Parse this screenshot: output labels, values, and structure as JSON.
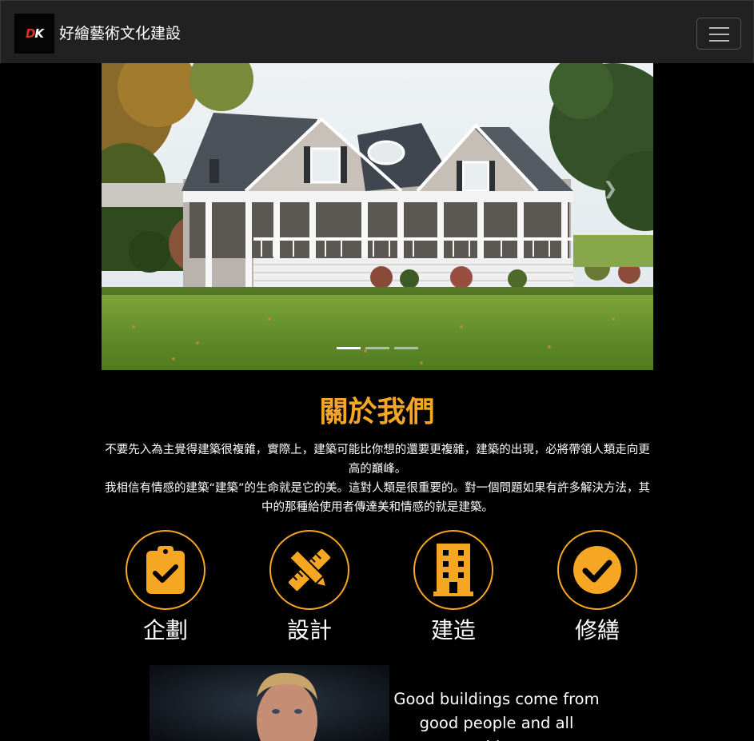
{
  "navbar": {
    "logo_text": "DK",
    "brand": "好繪藝術文化建設",
    "menu_icon": "hamburger-menu-icon"
  },
  "carousel": {
    "slide_count": 3,
    "active_slide": 1,
    "next_icon": "chevron-right-icon"
  },
  "about": {
    "title": "關於我們",
    "paragraph_1": "不要先入為主覺得建築很複雜，實際上，建築可能比你想的還要更複雜，建築的出現，必將帶領人類走向更高的巔峰。",
    "paragraph_2": "我相信有情感的建築“建築”的生命就是它的美。這對人類是很重要的。對一個問題如果有許多解決方法，其中的那種給使用者傳達美和情感的就是建築。"
  },
  "services": [
    {
      "label": "企劃",
      "icon": "clipboard-check-icon"
    },
    {
      "label": "設計",
      "icon": "pencil-ruler-icon"
    },
    {
      "label": "建造",
      "icon": "building-icon"
    },
    {
      "label": "修繕",
      "icon": "check-circle-icon"
    }
  ],
  "quote": {
    "line_1": "Good buildings come from",
    "line_2": "good people and all problems"
  },
  "colors": {
    "accent": "#f5a623",
    "navbar_bg": "#212121",
    "page_bg": "#000000"
  }
}
